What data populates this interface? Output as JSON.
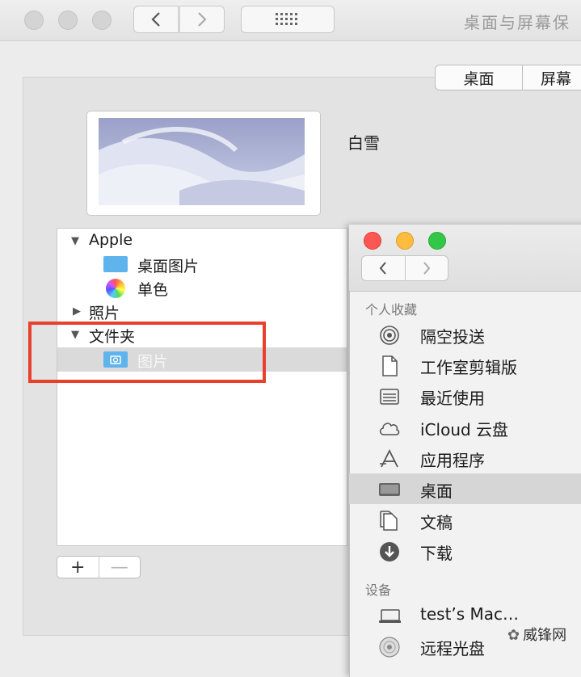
{
  "window": {
    "title": "桌面与屏幕保"
  },
  "tabs": [
    {
      "label": "桌面"
    },
    {
      "label": "屏幕"
    }
  ],
  "wallpaper": {
    "name": "白雪"
  },
  "source_list": {
    "groups": [
      {
        "label": "Apple",
        "expanded": true,
        "items": [
          {
            "label": "桌面图片",
            "icon": "folder-icon"
          },
          {
            "label": "单色",
            "icon": "color-wheel-icon"
          }
        ]
      },
      {
        "label": "照片",
        "expanded": false,
        "items": []
      },
      {
        "label": "文件夹",
        "expanded": true,
        "items": [
          {
            "label": "图片",
            "icon": "pictures-folder-icon",
            "selected": true
          }
        ]
      }
    ],
    "add_label": "+",
    "remove_label": "—"
  },
  "finder": {
    "favorites_header": "个人收藏",
    "favorites": [
      {
        "label": "隔空投送",
        "icon": "airdrop-icon"
      },
      {
        "label": "工作室剪辑版",
        "icon": "document-icon"
      },
      {
        "label": "最近使用",
        "icon": "recents-icon"
      },
      {
        "label": "iCloud 云盘",
        "icon": "cloud-icon"
      },
      {
        "label": "应用程序",
        "icon": "applications-icon"
      },
      {
        "label": "桌面",
        "icon": "desktop-icon",
        "selected": true
      },
      {
        "label": "文稿",
        "icon": "documents-icon"
      },
      {
        "label": "下载",
        "icon": "downloads-icon"
      }
    ],
    "devices_header": "设备",
    "devices": [
      {
        "label": "test’s Mac…",
        "icon": "laptop-icon"
      },
      {
        "label": "远程光盘",
        "icon": "disc-icon"
      }
    ]
  },
  "watermark": "威锋网",
  "colors": {
    "highlight_box": "#e8402c",
    "folder_blue": "#5fb4ee",
    "traffic_red": "#fc5753",
    "traffic_yellow": "#fdbc40",
    "traffic_green": "#33c748"
  }
}
